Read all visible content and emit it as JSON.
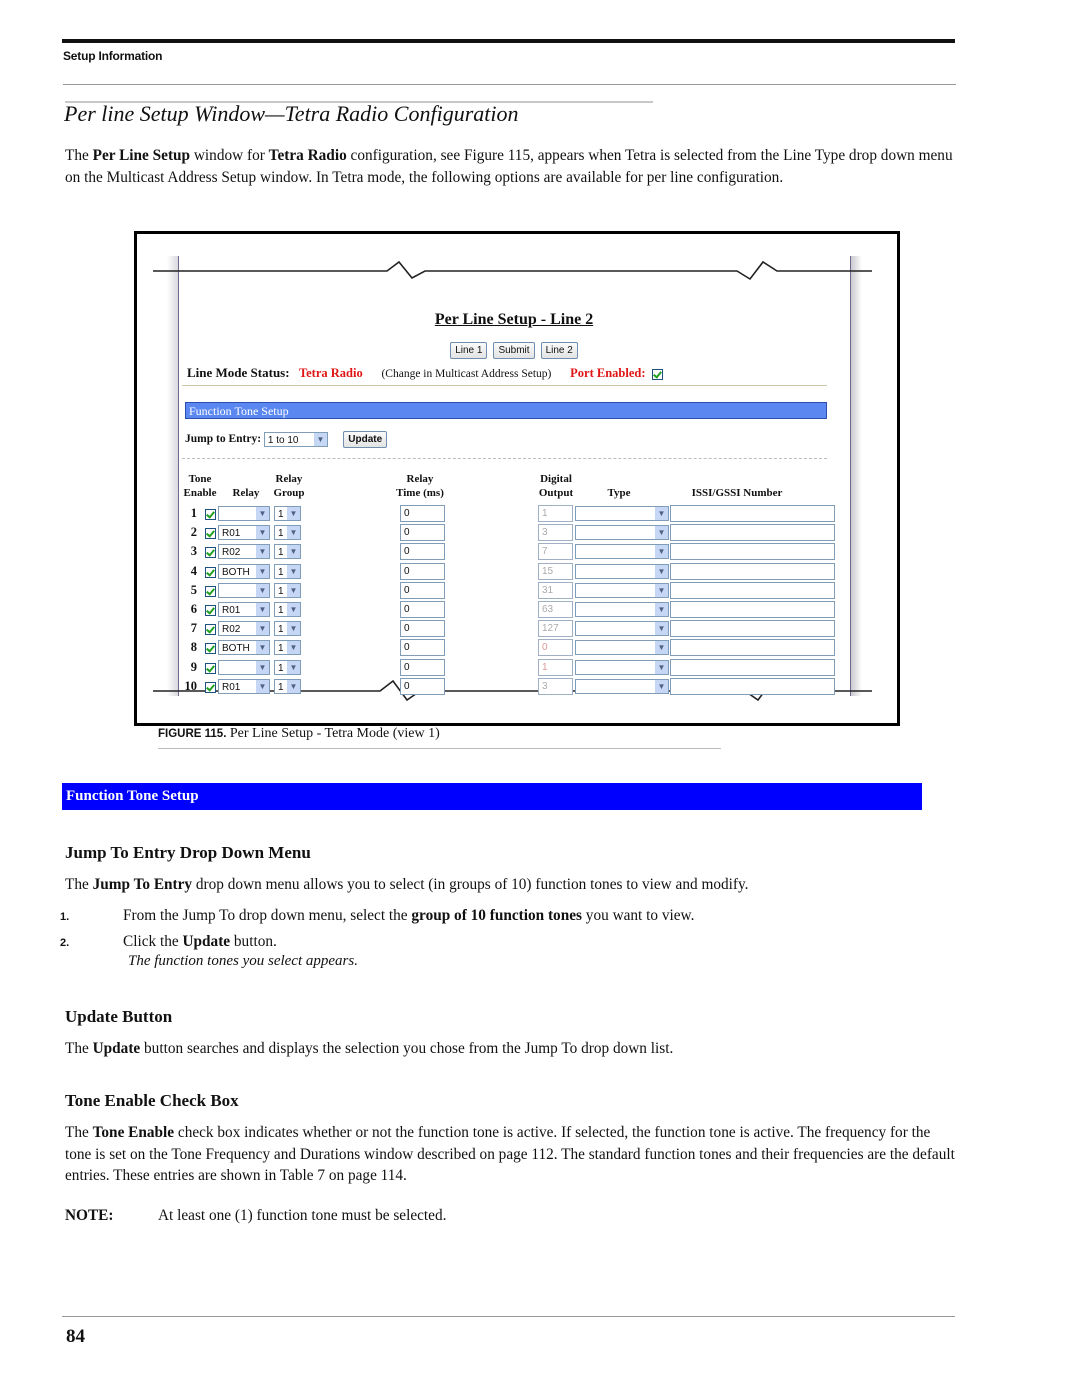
{
  "header": {
    "running_head": "Setup Information"
  },
  "section": {
    "title": "Per line Setup Window—Tetra Radio Configuration",
    "intro": {
      "p1": "The ",
      "b1": "Per Line Setup",
      "p2": " window for ",
      "b2": "Tetra Radio",
      "p3": " configuration, see Figure 115, appears when Tetra is selected from the Line Type drop down menu on the Multicast Address Setup window. In Tetra mode, the following options are available for per line configuration."
    }
  },
  "figure": {
    "window": {
      "title": "Per Line Setup - Line 2",
      "buttons": [
        "Line 1",
        "Submit",
        "Line 2"
      ],
      "line_mode_label": "Line Mode Status:",
      "line_mode_value": "Tetra Radio",
      "change_note": "(Change in Multicast Address Setup)",
      "port_enabled_label": "Port Enabled:",
      "port_enabled_checked": true,
      "function_tone_bar": "Function Tone Setup",
      "jump_label": "Jump to Entry:",
      "jump_value": "1 to 10",
      "update_button": "Update",
      "columns": {
        "tone_enable": [
          "Tone",
          "Enable"
        ],
        "relay": "Relay",
        "relay_group": [
          "Relay",
          "Group"
        ],
        "relay_time": [
          "Relay",
          "Time (ms)"
        ],
        "digital_output": [
          "Digital",
          "Output"
        ],
        "type": "Type",
        "issi": "ISSI/GSSI Number"
      },
      "rows": [
        {
          "num": "1",
          "enabled": true,
          "relay": "",
          "group": "1",
          "time": "0",
          "output": "1",
          "type": "",
          "issi": ""
        },
        {
          "num": "2",
          "enabled": true,
          "relay": "R01",
          "group": "1",
          "time": "0",
          "output": "3",
          "type": "",
          "issi": ""
        },
        {
          "num": "3",
          "enabled": true,
          "relay": "R02",
          "group": "1",
          "time": "0",
          "output": "7",
          "type": "",
          "issi": ""
        },
        {
          "num": "4",
          "enabled": true,
          "relay": "BOTH",
          "group": "1",
          "time": "0",
          "output": "15",
          "type": "",
          "issi": ""
        },
        {
          "num": "5",
          "enabled": true,
          "relay": "",
          "group": "1",
          "time": "0",
          "output": "31",
          "type": "",
          "issi": ""
        },
        {
          "num": "6",
          "enabled": true,
          "relay": "R01",
          "group": "1",
          "time": "0",
          "output": "63",
          "type": "",
          "issi": ""
        },
        {
          "num": "7",
          "enabled": true,
          "relay": "R02",
          "group": "1",
          "time": "0",
          "output": "127",
          "type": "",
          "issi": ""
        },
        {
          "num": "8",
          "enabled": true,
          "relay": "BOTH",
          "group": "1",
          "time": "0",
          "output": "0",
          "type": "",
          "issi": ""
        },
        {
          "num": "9",
          "enabled": true,
          "relay": "",
          "group": "1",
          "time": "0",
          "output": "1",
          "type": "",
          "issi": ""
        },
        {
          "num": "10",
          "enabled": true,
          "relay": "R01",
          "group": "1",
          "time": "0",
          "output": "3",
          "type": "",
          "issi": ""
        }
      ]
    },
    "caption_label": "FIGURE 115.",
    "caption_text": " Per Line Setup - Tetra Mode (view 1)"
  },
  "function_tone_setup_bar": "Function Tone Setup",
  "jump_section": {
    "heading": "Jump To Entry Drop Down Menu",
    "p1": "The ",
    "b1": "Jump To Entry",
    "p2": " drop down menu allows you to select (in groups of 10) function tones to view and modify.",
    "steps": [
      {
        "n": "1.",
        "pre": "From the Jump To drop down menu, select the ",
        "bold": "group of 10 function tones",
        "post": " you want to view."
      },
      {
        "n": "2.",
        "pre": "Click the ",
        "bold": "Update",
        "post": " button."
      }
    ],
    "result": "The function tones you select appears."
  },
  "update_section": {
    "heading": "Update Button",
    "p1": "The ",
    "b1": "Update",
    "p2": " button searches and displays the selection you chose from the Jump To drop down list."
  },
  "tone_section": {
    "heading": "Tone Enable Check Box",
    "p1": "The ",
    "b1": "Tone Enable",
    "p2": " check box indicates whether or not the function tone is active. If selected, the function tone is active. The frequency for the tone is set on the Tone Frequency and Durations window described on page 112. The standard function tones and their frequencies are the default entries. These entries are shown in Table 7 on page 114."
  },
  "note": {
    "label": "NOTE:",
    "text": "At least one (1) function tone must be selected."
  },
  "footer": {
    "page_number": "84"
  },
  "colors": {
    "blue_bar": "#0000ff",
    "window_bar": "#5a88f0",
    "status_red": "#e01515"
  }
}
